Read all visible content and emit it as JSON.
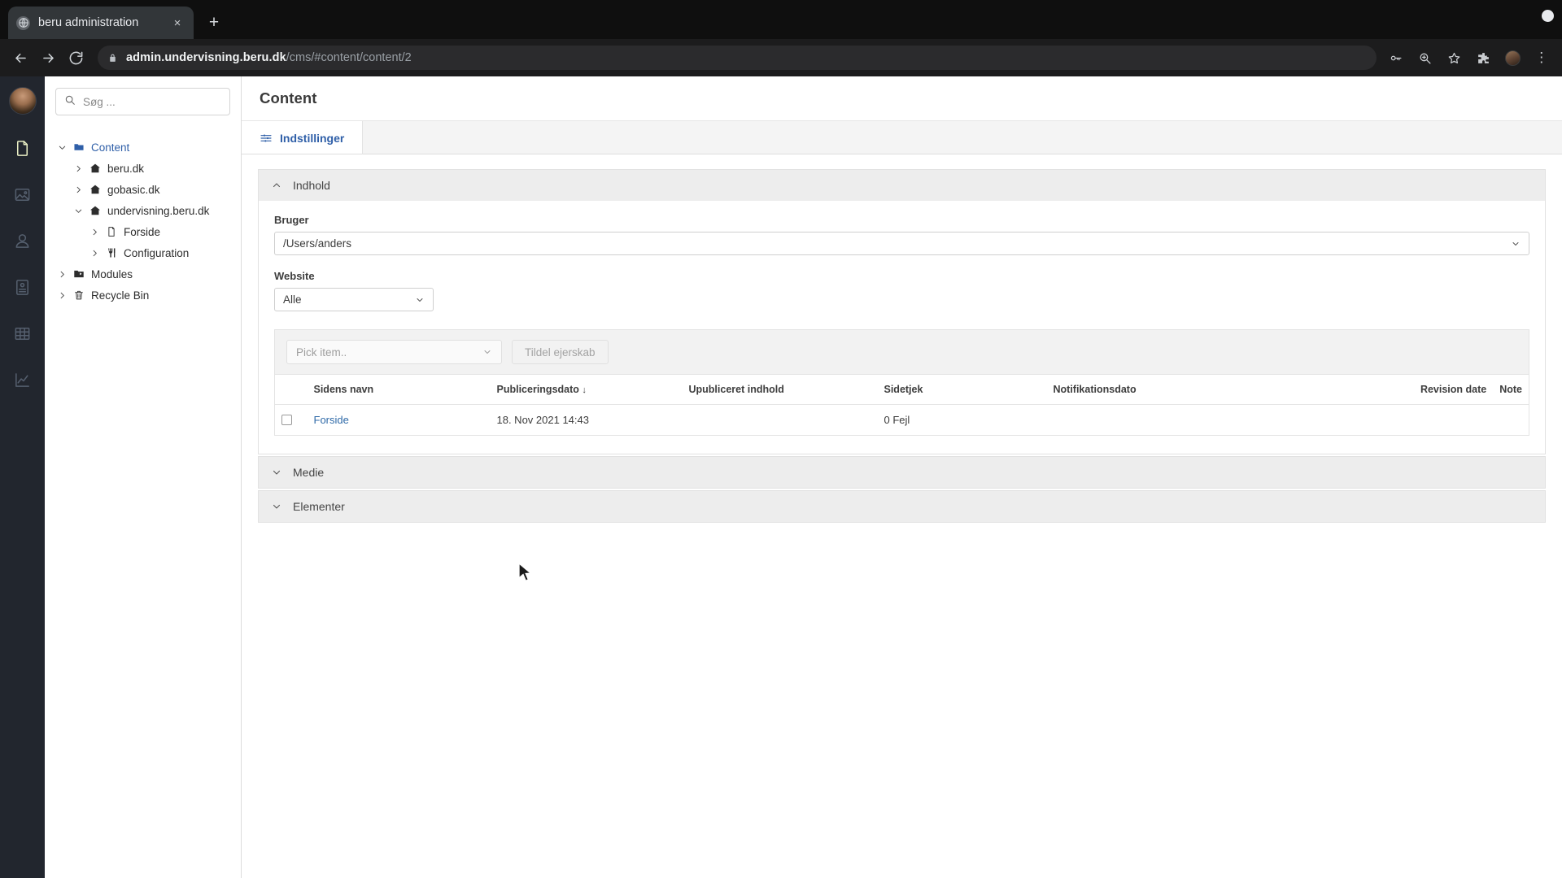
{
  "browser": {
    "tab": {
      "title": "beru administration",
      "favicon": "globe-icon",
      "close": "×"
    },
    "new_tab": "+",
    "url": {
      "domain": "admin.undervisning.beru.dk",
      "path": "/cms/#content/content/2"
    },
    "toolbar_icons": [
      "back-icon",
      "forward-icon",
      "reload-icon",
      "password-key-icon",
      "zoom-icon",
      "bookmark-star-icon",
      "extensions-icon",
      "profile-avatar",
      "menu-kebab-icon"
    ],
    "kebab": "⋮"
  },
  "rail": {
    "items": [
      {
        "name": "avatar",
        "icon": "user-avatar"
      },
      {
        "name": "content",
        "icon": "document-icon",
        "active": true
      },
      {
        "name": "media",
        "icon": "image-icon",
        "active": false
      },
      {
        "name": "users",
        "icon": "user-icon",
        "active": false
      },
      {
        "name": "members",
        "icon": "member-card-icon",
        "active": false
      },
      {
        "name": "forms",
        "icon": "table-grid-icon",
        "active": false
      },
      {
        "name": "analytics",
        "icon": "chart-line-icon",
        "active": false
      }
    ]
  },
  "sidebar": {
    "search": {
      "placeholder": "Søg ...",
      "value": "",
      "icon": "search-icon"
    },
    "tree": [
      {
        "label": "Content",
        "level": 0,
        "icon": "folder-icon",
        "expanded": true,
        "root": true
      },
      {
        "label": "beru.dk",
        "level": 1,
        "icon": "home-icon",
        "expanded": false,
        "root": false
      },
      {
        "label": "gobasic.dk",
        "level": 1,
        "icon": "home-icon",
        "expanded": false,
        "root": false
      },
      {
        "label": "undervisning.beru.dk",
        "level": 1,
        "icon": "home-icon",
        "expanded": true,
        "root": false
      },
      {
        "label": "Forside",
        "level": 2,
        "icon": "document-icon",
        "expanded": false,
        "root": false
      },
      {
        "label": "Configuration",
        "level": 2,
        "icon": "settings-fork-icon",
        "expanded": false,
        "root": false
      },
      {
        "label": "Modules",
        "level": 0,
        "icon": "modules-folder-icon",
        "expanded": false,
        "root": false
      },
      {
        "label": "Recycle Bin",
        "level": 0,
        "icon": "trash-icon",
        "expanded": false,
        "root": false
      }
    ]
  },
  "main": {
    "title": "Content",
    "tabs": [
      {
        "label": "Indstillinger",
        "icon": "sliders-icon",
        "active": true
      }
    ],
    "panels": [
      {
        "id": "indhold",
        "title": "Indhold",
        "expanded": true
      },
      {
        "id": "medie",
        "title": "Medie",
        "expanded": false
      },
      {
        "id": "elementer",
        "title": "Elementer",
        "expanded": false
      }
    ],
    "form": {
      "bruger": {
        "label": "Bruger",
        "value": "/Users/anders"
      },
      "website": {
        "label": "Website",
        "value": "Alle"
      }
    },
    "assign": {
      "pick_placeholder": "Pick item..",
      "button_label": "Tildel ejerskab"
    },
    "table": {
      "columns": [
        "Sidens navn",
        "Publiceringsdato",
        "Upubliceret indhold",
        "Sidetjek",
        "Notifikationsdato",
        "Revision date",
        "Note"
      ],
      "sorted_column": "Publiceringsdato",
      "sort_arrow": "↓",
      "rows": [
        {
          "checked": false,
          "name": "Forside",
          "published": "18. Nov 2021 14:43",
          "unpublished": "",
          "sitecheck": "0 Fejl",
          "notification": "",
          "revision": "",
          "note": ""
        }
      ]
    }
  },
  "colors": {
    "accent_blue": "#2f5fa8",
    "link_blue": "#2f6aa8",
    "rail_bg": "#22262e",
    "rail_active": "#e9eec4",
    "panel_head": "#ededed"
  }
}
